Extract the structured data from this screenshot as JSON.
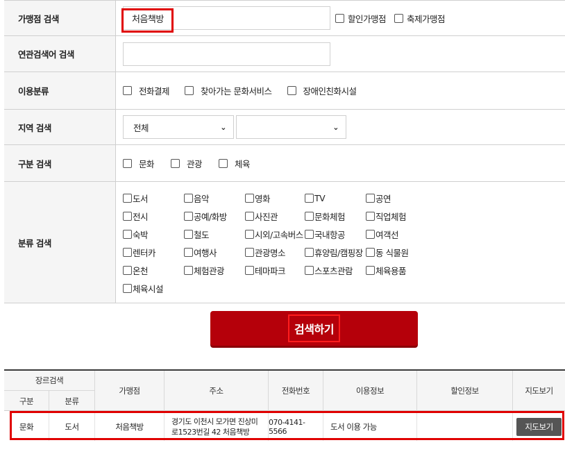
{
  "form": {
    "store_label": "가맹점 검색",
    "store_value": "처음책방",
    "discount_store": "할인가맹점",
    "festival_store": "축제가맹점",
    "related_label": "연관검색어 검색",
    "related_value": "",
    "usage_label": "이용분류",
    "usage_options": [
      "전화결제",
      "찾아가는 문화서비스",
      "장애인친화시설"
    ],
    "region_label": "지역 검색",
    "region_select": "전체",
    "region_sub_select": "",
    "category_label": "구분 검색",
    "category_options": [
      "문화",
      "관광",
      "체육"
    ],
    "class_label": "분류 검색",
    "class_options": [
      "도서",
      "음악",
      "영화",
      "TV",
      "공연",
      "전시",
      "공예/화방",
      "사진관",
      "문화체험",
      "직업체험",
      "숙박",
      "철도",
      "시외/고속버스",
      "국내항공",
      "여객선",
      "렌터카",
      "여행사",
      "관광명소",
      "휴양림/캠핑장",
      "동 식물원",
      "온천",
      "체험관광",
      "테마파크",
      "스포츠관람",
      "체육용품",
      "체육시설"
    ]
  },
  "search_button": "검색하기",
  "results": {
    "headers": {
      "genre_search": "장르검색",
      "division": "구분",
      "class": "분류",
      "store": "가맹점",
      "address": "주소",
      "phone": "전화번호",
      "usage": "이용정보",
      "discount": "할인정보",
      "map": "지도보기"
    },
    "rows": [
      {
        "division": "문화",
        "class": "도서",
        "store": "처음책방",
        "address_line1": "경기도 이천시 모가면 진상미",
        "address_line2": "로1523번길 42 처음책방",
        "phone": "070-4141-5566",
        "usage": "도서 이용 가능",
        "discount": "",
        "map_button": "지도보기"
      }
    ]
  },
  "colors": {
    "accent": "#b5000a",
    "highlight": "#e00000",
    "map_button": "#555555"
  }
}
